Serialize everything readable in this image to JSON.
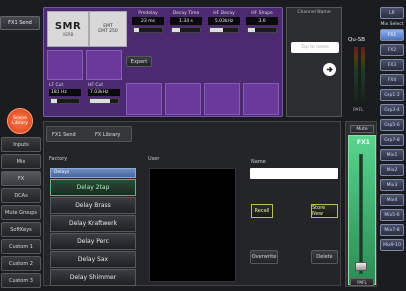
{
  "fx_send_tab": "FX1 Send",
  "fx": {
    "logo": "SMR",
    "logo_sub": "VERB",
    "model": "EMT\nEMT 250",
    "params": [
      {
        "label": "Predelay",
        "value": "23 ms"
      },
      {
        "label": "Decay Time",
        "value": "1.34 s"
      },
      {
        "label": "HF Decay",
        "value": "5.03kHz"
      },
      {
        "label": "HF Shape",
        "value": "3.0"
      }
    ],
    "expert_label": "Expert",
    "lf_params": [
      {
        "label": "LF Cut",
        "value": "181 Hz"
      },
      {
        "label": "HF Cut",
        "value": "7.03kHz"
      }
    ]
  },
  "channel_name": {
    "header": "Channel Name",
    "placeholder": "Tap to name"
  },
  "left_nav": {
    "scene_library": "Scene Library",
    "items": [
      "Inputs",
      "Mix",
      "FX",
      "DCAs",
      "Mute Groups",
      "SoftKeys",
      "Custom 1",
      "Custom 2",
      "Custom 3"
    ]
  },
  "library": {
    "tab1": "FX1 Send",
    "tab2": "FX Library",
    "factory_label": "Factory",
    "user_label": "User",
    "category": "Delays",
    "items": [
      "Delay 2tap",
      "Delay Brass",
      "Delay Kraftwerk",
      "Delay Perc",
      "Delay Sax",
      "Delay Shimmer"
    ],
    "name_label": "Name",
    "recall": "Recall",
    "store_new": "Store New",
    "overwrite": "Overwrite",
    "delete": "Delete"
  },
  "right": {
    "device": "Qu-SB",
    "lr": "LR",
    "mix_select": "Mix Select",
    "fx_buttons": [
      "FX1",
      "FX2",
      "FX3",
      "FX4",
      "Grp1-2",
      "Grp3-4",
      "Grp5-6",
      "Grp7-8"
    ],
    "mix_buttons": [
      "Mix1",
      "Mix2",
      "Mix3",
      "Mix4",
      "Mix5-6",
      "Mix7-8",
      "Mix9-10"
    ],
    "mute_label": "Mute",
    "fx1_label": "FX1",
    "pafl": "PAFL",
    "pafl2": "PAFL"
  },
  "colors": {
    "accent": "#e4552a",
    "purple": "#6a3a9a",
    "green": "#4cbf7a",
    "blue": "#5b80c4"
  }
}
